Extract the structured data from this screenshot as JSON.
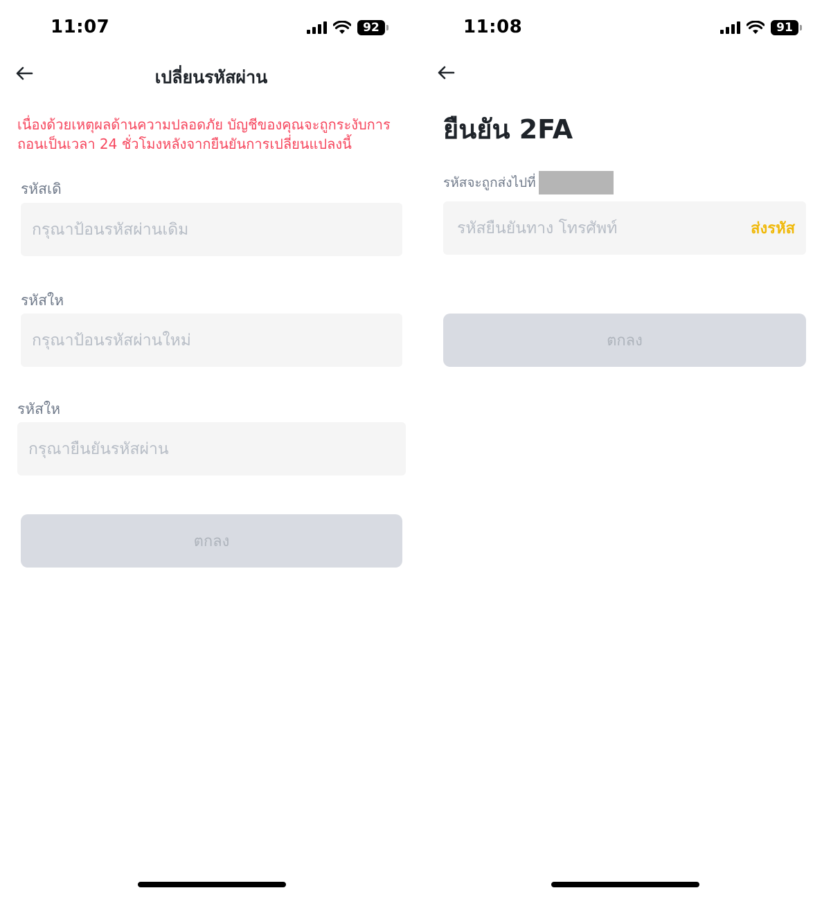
{
  "screen_left": {
    "status": {
      "time": "11:07",
      "battery": "92"
    },
    "title": "เปลี่ยนรหัสผ่าน",
    "warning": "เนื่องด้วยเหตุผลด้านความปลอดภัย บัญชีของคุณจะถูกระงับการถอนเป็นเวลา 24 ชั่วโมงหลังจากยืนยันการเปลี่ยนแปลงนี้",
    "fields": [
      {
        "label": "รหัสเดิ",
        "placeholder": "กรุณาป้อนรหัสผ่านเดิม"
      },
      {
        "label": "รหัสให",
        "placeholder": "กรุณาป้อนรหัสผ่านใหม่"
      },
      {
        "label": "รหัสให",
        "placeholder": "กรุณายืนยันรหัสผ่าน"
      }
    ],
    "submit_label": "ตกลง"
  },
  "screen_right": {
    "status": {
      "time": "11:08",
      "battery": "91"
    },
    "title": "ยืนยัน 2FA",
    "sent_to_label": "รหัสจะถูกส่งไปที่",
    "code_placeholder": "รหัสยืนยันทาง โทรศัพท์",
    "send_code_label": "ส่งรหัส",
    "submit_label": "ตกลง"
  },
  "colors": {
    "warning": "#f6465d",
    "accent": "#f0b90b",
    "input_bg": "#f5f5f5",
    "button_disabled_bg": "#d8dbe2",
    "button_disabled_text": "#aeb4bc"
  },
  "icons": [
    "back-arrow-icon",
    "cellular-signal-icon",
    "wifi-icon",
    "battery-icon"
  ]
}
